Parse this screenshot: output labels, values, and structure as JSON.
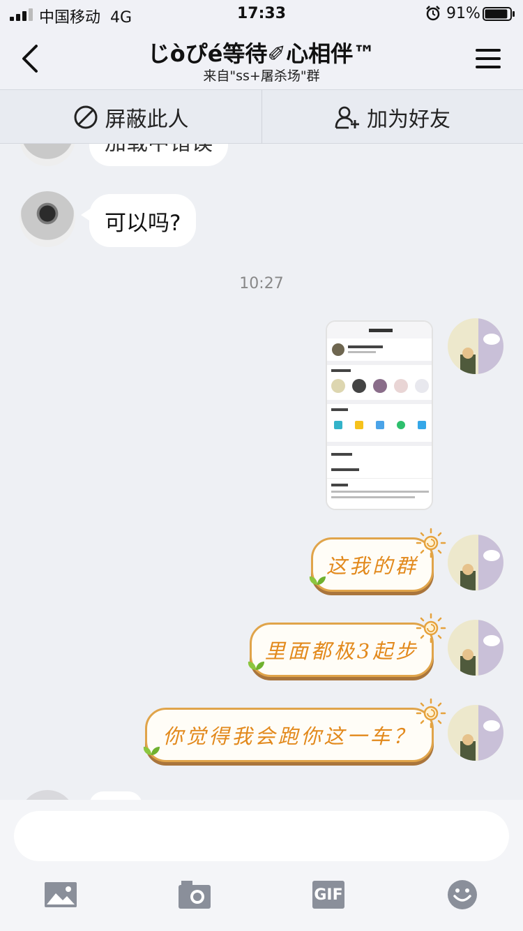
{
  "status_bar": {
    "carrier": "中国移动",
    "network": "4G",
    "time": "17:33",
    "battery": "91%",
    "battery_level": 0.91
  },
  "header": {
    "title": "じòぴé等待✐心相伴™",
    "subtitle": "来自\"ss+屠杀场\"群"
  },
  "actions": {
    "block_label": "屏蔽此人",
    "add_friend_label": "加为好友"
  },
  "messages": {
    "partial_text": "加载中错误",
    "left_text": "可以吗?",
    "timestamp": "10:27",
    "right_1": "这我的群",
    "right_2": "里面都极3起步",
    "right_3": "你觉得我会跑你这一车？"
  },
  "input": {
    "placeholder": ""
  },
  "toolbar": {
    "gif_label": "GIF"
  },
  "colors": {
    "accent_orange": "#e2891c",
    "bubble_border": "#e0a44a",
    "background": "#eef0f4"
  }
}
